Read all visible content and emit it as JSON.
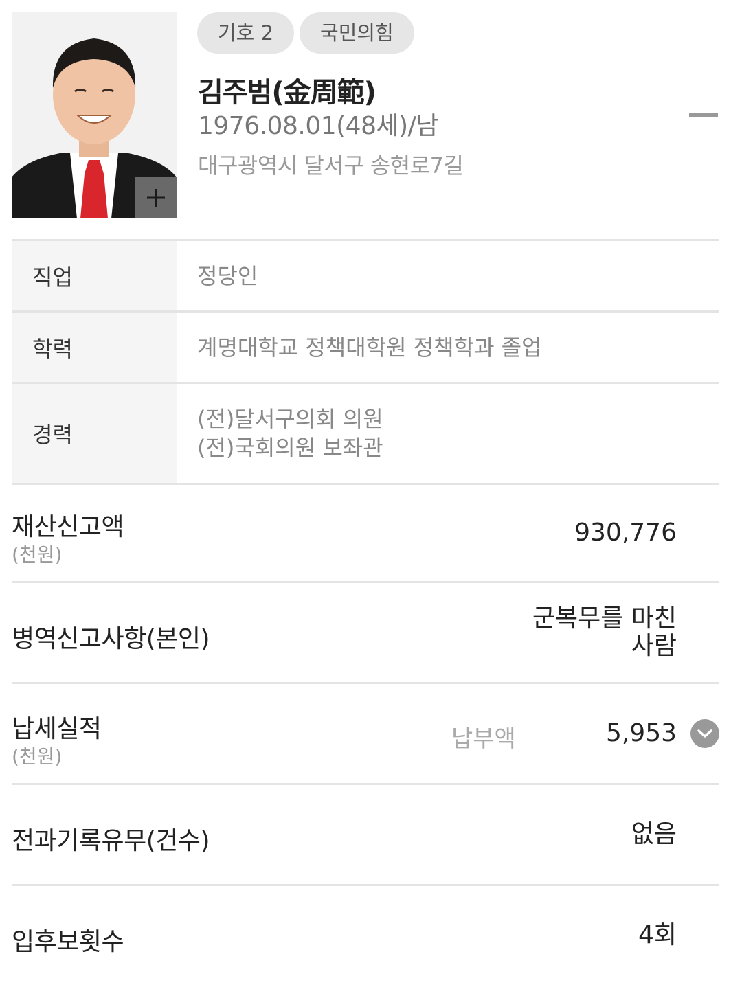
{
  "candidate": {
    "number": "기호 2",
    "party": "국민의힘",
    "name": "김주범(金周範)",
    "birth": "1976.08.01(48세)/남",
    "address": "대구광역시 달서구 송현로7길"
  },
  "info": {
    "job": {
      "label": "직업",
      "value": "정당인"
    },
    "education": {
      "label": "학력",
      "value": "계명대학교 정책대학원 정책학과 졸업"
    },
    "career": {
      "label": "경력",
      "lines": [
        "(전)달서구의회 의원",
        "(전)국회의원 보좌관"
      ]
    }
  },
  "details": {
    "property": {
      "label": "재산신고액",
      "unit": "(천원)",
      "value": "930,776"
    },
    "military": {
      "label": "병역신고사항(본인)",
      "value_line1": "군복무를 마친",
      "value_line2": "사람"
    },
    "tax": {
      "label": "납세실적",
      "unit": "(천원)",
      "sub_label": "납부액",
      "value": "5,953"
    },
    "criminal": {
      "label": "전과기록유무(건수)",
      "value": "없음"
    },
    "candidacy": {
      "label": "입후보횟수",
      "value": "4회"
    }
  },
  "icons": {
    "expand": "plus-icon",
    "collapse": "minus-icon",
    "dropdown": "chevron-down-icon"
  },
  "colors": {
    "badge_bg": "#e6e6e6",
    "muted_text": "#999999",
    "divider": "#e4e4e4",
    "label_bg": "#f5f5f5",
    "tie_red": "#d9262c"
  }
}
